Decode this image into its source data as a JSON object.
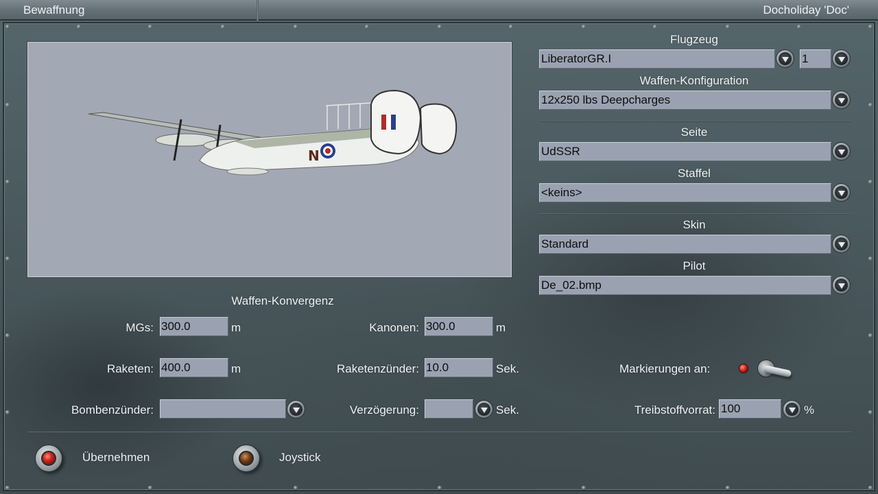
{
  "header": {
    "section_title": "Bewaffnung",
    "player_name": "Docholiday 'Doc'"
  },
  "aircraft_preview": {
    "fuselage_letter": "N",
    "colors": {
      "background": "#a2a9b4",
      "aircraft": "#eef0ee",
      "roundel_red": "#b32a2a",
      "roundel_blue": "#2a3f8a"
    }
  },
  "right_panel": {
    "flugzeug_label": "Flugzeug",
    "flugzeug_value": "LiberatorGR.I",
    "count_value": "1",
    "waffen_konfig_label": "Waffen-Konfiguration",
    "waffen_konfig_value": "12x250 lbs Deepcharges",
    "seite_label": "Seite",
    "seite_value": "UdSSR",
    "staffel_label": "Staffel",
    "staffel_value": "<keins>",
    "skin_label": "Skin",
    "skin_value": "Standard",
    "pilot_label": "Pilot",
    "pilot_value": "De_02.bmp"
  },
  "convergence": {
    "title": "Waffen-Konvergenz",
    "mgs_label": "MGs:",
    "mgs_value": "300.0",
    "mgs_unit": "m",
    "kanonen_label": "Kanonen:",
    "kanonen_value": "300.0",
    "kanonen_unit": "m",
    "raketen_label": "Raketen:",
    "raketen_value": "400.0",
    "raketen_unit": "m",
    "raketenzuender_label": "Raketenzünder:",
    "raketenzuender_value": "10.0",
    "raketenzuender_unit": "Sek.",
    "bombenzuender_label": "Bombenzünder:",
    "bombenzuender_value": "",
    "verzoegerung_label": "Verzögerung:",
    "verzoegerung_value": "",
    "verzoegerung_unit": "Sek.",
    "markierungen_label": "Markierungen an:",
    "treibstoff_label": "Treibstoffvorrat:",
    "treibstoff_value": "100",
    "treibstoff_unit": "%"
  },
  "footer": {
    "apply_label": "Übernehmen",
    "joystick_label": "Joystick"
  },
  "theme": {
    "field_bg": "#9aa2b1",
    "panel_bg": "#4a595e",
    "text": "#eef2f4"
  }
}
